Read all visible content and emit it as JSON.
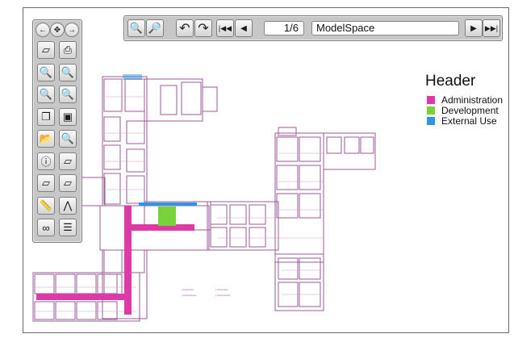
{
  "toolbar": {
    "page_indicator": "1/6",
    "layout_name": "ModelSpace"
  },
  "legend": {
    "title": "Header",
    "items": [
      {
        "label": "Administration",
        "color": "#dd3aa8"
      },
      {
        "label": "Development",
        "color": "#78d23a"
      },
      {
        "label": "External Use",
        "color": "#2f95e0"
      }
    ]
  },
  "side_tools": [
    "layer-icon",
    "print-icon",
    "zoom-in-icon",
    "zoom-out-icon",
    "zoom-window-icon",
    "zoom-extents-icon",
    "copy-icon",
    "color-icon",
    "open-folder-icon",
    "zoom-text-icon",
    "info-icon",
    "layer-remove-icon",
    "layer-swap-icon",
    "layer-add-icon",
    "measure-icon",
    "compass-icon",
    "binoculars-icon",
    "list-icon"
  ],
  "colors": {
    "plan_line": "#a05fa0",
    "accent": "#dd3aa8",
    "green": "#78d23a",
    "blue": "#2f95e0"
  }
}
